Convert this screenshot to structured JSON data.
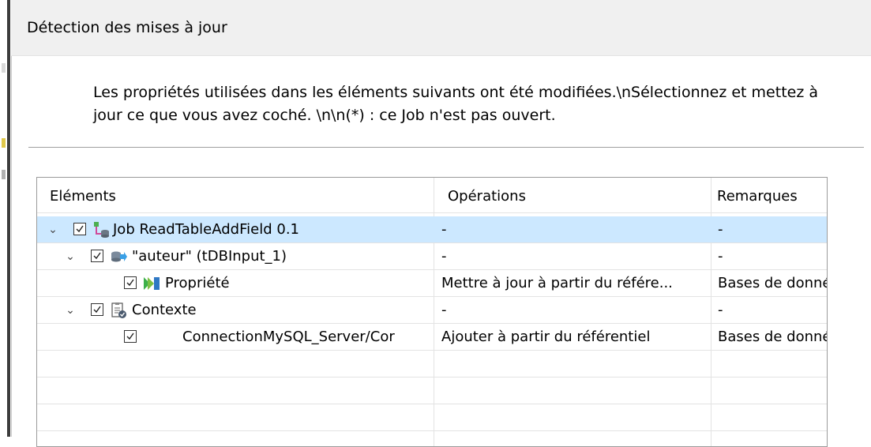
{
  "dialog": {
    "title": "Détection des mises à jour",
    "message": "Les propriétés utilisées dans les éléments suivants ont été modifiées.\\nSélectionnez et mettez à jour ce que vous avez coché. \\n\\n(*) : ce Job n'est pas ouvert."
  },
  "table": {
    "columns": [
      "Eléments",
      "Opérations",
      "Remarques"
    ],
    "rows": [
      {
        "element": "Job ReadTableAddField 0.1",
        "operation": "-",
        "remark": "-",
        "icon": "job-icon",
        "checked": true,
        "expanded": true,
        "selected": true
      },
      {
        "element": "\"auteur\" (tDBInput_1)",
        "operation": "-",
        "remark": "-",
        "icon": "db-input-component-icon",
        "checked": true,
        "expanded": true,
        "selected": false
      },
      {
        "element": "Propriété",
        "operation": "Mettre à jour à partir du référe...",
        "remark": "Bases de donné",
        "icon": "property-icon",
        "checked": true,
        "selected": false
      },
      {
        "element": "Contexte",
        "operation": "-",
        "remark": "-",
        "icon": "context-icon",
        "checked": true,
        "expanded": true,
        "selected": false
      },
      {
        "element": "ConnectionMySQL_Server/Cor",
        "operation": "Ajouter à partir du référentiel",
        "remark": "Bases de donné",
        "checked": true,
        "selected": false
      }
    ]
  },
  "colors": {
    "selection": "#cce8ff",
    "title_bar": "#f0f0f0",
    "grid_line": "#e3e3e3"
  }
}
